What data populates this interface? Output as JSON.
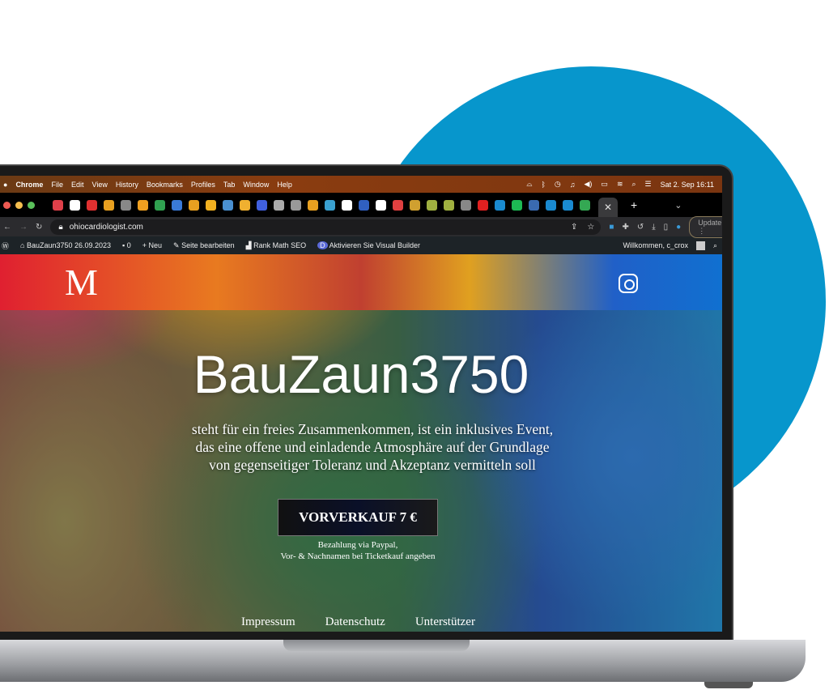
{
  "colors": {
    "accent_circle": "#0796cc",
    "wp_bar": "#1d2327"
  },
  "menubar": {
    "apple": "",
    "items": [
      "Chrome",
      "File",
      "Edit",
      "View",
      "History",
      "Bookmarks",
      "Profiles",
      "Tab",
      "Window",
      "Help"
    ],
    "datetime": "Sat 2. Sep  16:11"
  },
  "tabs": {
    "close": "✕",
    "new": "+",
    "chevron": "⌄",
    "favicon_colors": [
      "#e0404a",
      "#fff",
      "#e03030",
      "#e8a020",
      "#888",
      "#f0a020",
      "#30a050",
      "#3a7ad8",
      "#e8a020",
      "#f0b020",
      "#4a90d0",
      "#f0b030",
      "#4060e0",
      "#aaa",
      "#999",
      "#e8a020",
      "#3aa0d0",
      "#fff",
      "#3060c0",
      "#fff",
      "#e04040",
      "#d0a030",
      "#a0b040",
      "#a0b040",
      "#888",
      "#e02020",
      "#1a8ad0",
      "#1db954",
      "#3a6ab0",
      "#1a8ad0",
      "#1a8ad0",
      "#34a853"
    ]
  },
  "address": {
    "url": "ohiocardiologist.com",
    "update": "Update"
  },
  "wpbar": {
    "site": "BauZaun3750 26.09.2023",
    "comments": "0",
    "new": "Neu",
    "edit": "Seite bearbeiten",
    "seo": "Rank Math SEO",
    "builder": "Aktivieren Sie Visual Builder",
    "welcome": "Willkommen, c_crox"
  },
  "page": {
    "logo": "M",
    "title": "BauZaun3750",
    "description": "steht für ein freies Zusammenkommen, ist ein inklusives Event, das eine offene und einladende Atmosphäre auf der Grundlage von gegenseitiger Toleranz und Akzeptanz vermitteln soll",
    "button": "VORVERKAUF 7 €",
    "payment_line1": "Bezahlung via Paypal,",
    "payment_line2": "Vor- & Nachnamen bei Ticketkauf angeben",
    "footer": [
      "Impressum",
      "Datenschutz",
      "Unterstützer"
    ]
  }
}
